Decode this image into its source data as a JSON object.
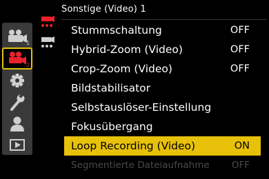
{
  "title": "Sonstige (Video) 1",
  "menu": {
    "items": [
      {
        "label": "Stummschaltung",
        "value": "OFF"
      },
      {
        "label": "Hybrid-Zoom (Video)",
        "value": "OFF"
      },
      {
        "label": "Crop-Zoom (Video)",
        "value": "OFF"
      },
      {
        "label": "Bildstabilisator",
        "value": ""
      },
      {
        "label": "Selbstauslöser-Einstellung",
        "value": ""
      },
      {
        "label": "Fokusübergang",
        "value": ""
      },
      {
        "label": "Loop Recording (Video)",
        "value": "ON"
      },
      {
        "label": "Segmentierte Dateiaufnahme",
        "value": "OFF"
      }
    ]
  },
  "sidebar": {
    "items": [
      {
        "icon": "photo-camera-icon",
        "badge": "1"
      },
      {
        "icon": "video-camera-icon",
        "badge": "2"
      },
      {
        "icon": "gear-icon"
      },
      {
        "icon": "wrench-icon"
      },
      {
        "icon": "user-icon"
      },
      {
        "icon": "playback-icon"
      }
    ]
  },
  "subtabs": {
    "items": [
      {
        "icon": "video-tab-1-icon"
      },
      {
        "icon": "video-tab-2-icon"
      }
    ]
  },
  "colors": {
    "accent": "#e7c10a",
    "active_icon": "#e8232c",
    "inactive_icon": "#cfcfcf",
    "disabled_text": "#4a4a4a"
  }
}
